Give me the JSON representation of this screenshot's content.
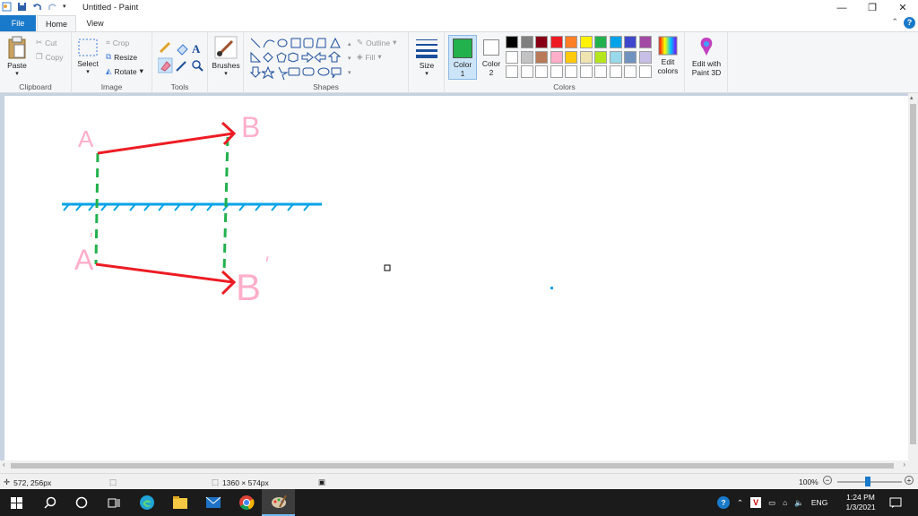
{
  "window": {
    "title": "Untitled - Paint"
  },
  "tabs": {
    "file": "File",
    "home": "Home",
    "view": "View"
  },
  "clipboard": {
    "paste": "Paste",
    "cut": "Cut",
    "copy": "Copy",
    "group": "Clipboard"
  },
  "image": {
    "select": "Select",
    "crop": "Crop",
    "resize": "Resize",
    "rotate": "Rotate",
    "group": "Image"
  },
  "tools": {
    "group": "Tools"
  },
  "brushes": {
    "label": "Brushes"
  },
  "shapes": {
    "outline": "Outline",
    "fill": "Fill",
    "group": "Shapes"
  },
  "size": {
    "label": "Size"
  },
  "colors": {
    "color1_label": "Color",
    "color1_num": "1",
    "color2_label": "Color",
    "color2_num": "2",
    "color1": "#22b14c",
    "color2": "#ffffff",
    "edit_colors": "Edit colors",
    "group": "Colors",
    "palette_row1": [
      "#000000",
      "#7f7f7f",
      "#880015",
      "#ed1c24",
      "#ff7f27",
      "#fff200",
      "#22b14c",
      "#00a2e8",
      "#3f48cc",
      "#a349a4"
    ],
    "palette_row2": [
      "#ffffff",
      "#c3c3c3",
      "#b97a57",
      "#ffaec9",
      "#ffc90e",
      "#efe4b0",
      "#b5e61d",
      "#99d9ea",
      "#7092be",
      "#c8bfe7"
    ]
  },
  "paint3d": {
    "label": "Edit with Paint 3D"
  },
  "drawing": {
    "label_a": "A",
    "label_b": "B",
    "label_a_prime": "A",
    "label_b_prime": "B",
    "prime_mark": "′",
    "arrow_color": "#ed1c24",
    "dash_color": "#22b14c",
    "line_color": "#00a2e8",
    "text_color": "#ffaec9"
  },
  "status": {
    "cursor_pos": "572, 256px",
    "canvas_size": "1360 × 574px",
    "zoom": "100%"
  },
  "taskbar": {
    "lang": "ENG",
    "time": "1:24 PM",
    "date": "1/3/2021"
  }
}
